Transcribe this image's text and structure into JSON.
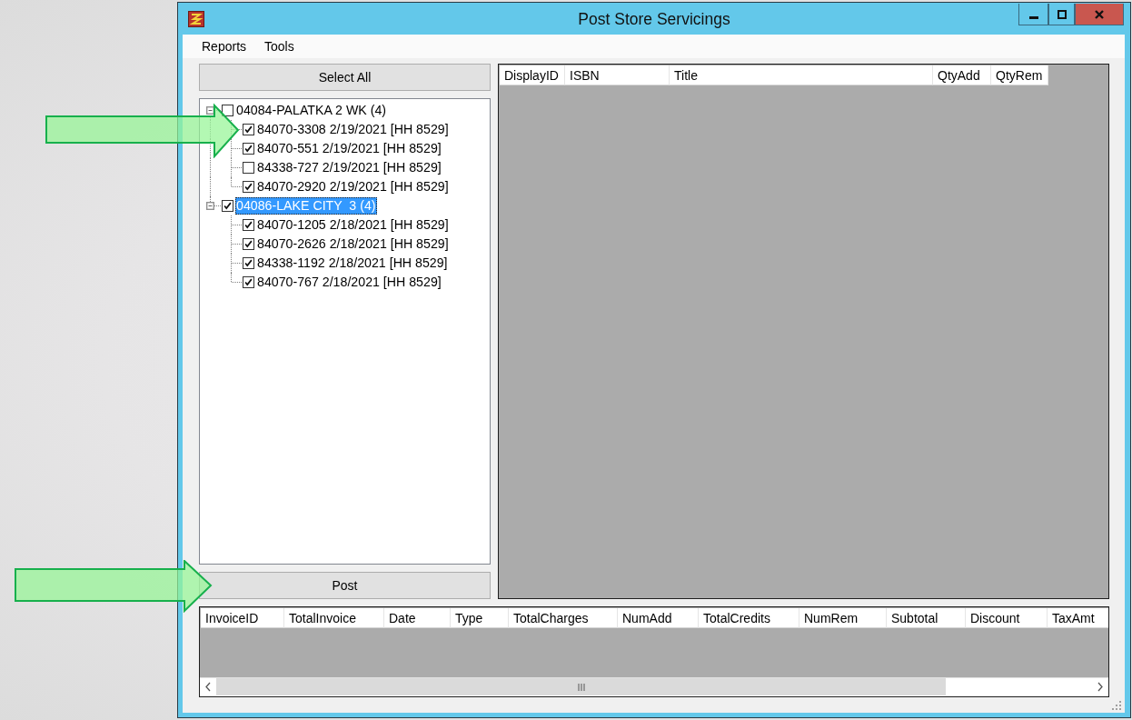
{
  "window": {
    "title": "Post Store Servicings"
  },
  "menu": [
    "Reports",
    "Tools"
  ],
  "select_all_button": "Select All",
  "tree": [
    {
      "label": "04084-PALATKA 2 WK (4)",
      "checked": false,
      "expanded": true,
      "selected": false,
      "children": [
        {
          "label": "84070-3308 2/19/2021 [HH 8529]",
          "checked": true,
          "selected": false
        },
        {
          "label": "84070-551 2/19/2021 [HH 8529]",
          "checked": true,
          "selected": false
        },
        {
          "label": "84338-727 2/19/2021 [HH 8529]",
          "checked": false,
          "selected": false
        },
        {
          "label": "84070-2920 2/19/2021 [HH 8529]",
          "checked": true,
          "selected": false
        }
      ]
    },
    {
      "label": "04086-LAKE CITY  3 (4)",
      "checked": true,
      "expanded": true,
      "selected": true,
      "children": [
        {
          "label": "84070-1205 2/18/2021 [HH 8529]",
          "checked": true,
          "selected": false
        },
        {
          "label": "84070-2626 2/18/2021 [HH 8529]",
          "checked": true,
          "selected": false
        },
        {
          "label": "84338-1192 2/18/2021 [HH 8529]",
          "checked": true,
          "selected": false
        },
        {
          "label": "84070-767 2/18/2021 [HH 8529]",
          "checked": true,
          "selected": false
        }
      ]
    }
  ],
  "items_grid": {
    "columns": [
      "DisplayID",
      "ISBN",
      "Title",
      "QtyAdd",
      "QtyRem"
    ]
  },
  "post_button": "Post",
  "invoice_grid": {
    "columns": [
      "InvoiceID",
      "TotalInvoice",
      "Date",
      "Type",
      "TotalCharges",
      "NumAdd",
      "TotalCredits",
      "NumRem",
      "Subtotal",
      "Discount",
      "TaxAmt"
    ]
  }
}
